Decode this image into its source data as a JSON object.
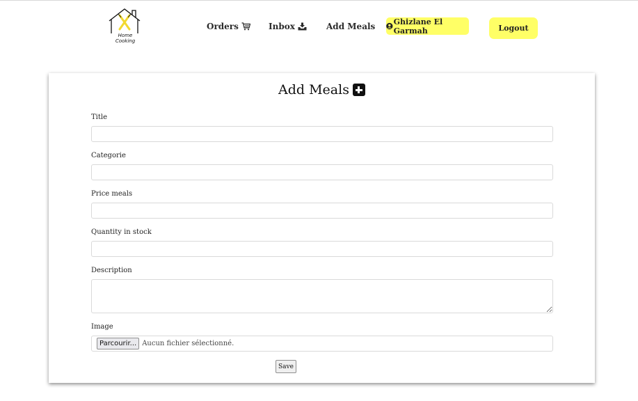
{
  "logo": {
    "icon": "house-spoon-fork-logo",
    "line1": "Home",
    "line2": "Cooking",
    "accent_color": "#f2d930"
  },
  "nav": {
    "orders": {
      "label": "Orders",
      "icon": "cart-icon"
    },
    "inbox": {
      "label": "Inbox",
      "icon": "inbox-download-icon"
    },
    "add_meals": {
      "label": "Add Meals"
    },
    "user": {
      "name": "Ghizlane El Garmah",
      "icon": "user-circle-icon"
    },
    "logout": {
      "label": "Logout"
    },
    "highlight_color": "#ffff66"
  },
  "form": {
    "title": "Add Meals",
    "title_icon": "plus-square-icon",
    "fields": {
      "title": {
        "label": "Title",
        "value": ""
      },
      "categorie": {
        "label": "Categorie",
        "value": ""
      },
      "price": {
        "label": "Price meals",
        "value": ""
      },
      "quantity": {
        "label": "Quantity in stock",
        "value": ""
      },
      "description": {
        "label": "Description",
        "value": ""
      },
      "image": {
        "label": "Image",
        "button": "Parcourir...",
        "status": "Aucun fichier sélectionné."
      }
    },
    "save_label": "Save"
  }
}
